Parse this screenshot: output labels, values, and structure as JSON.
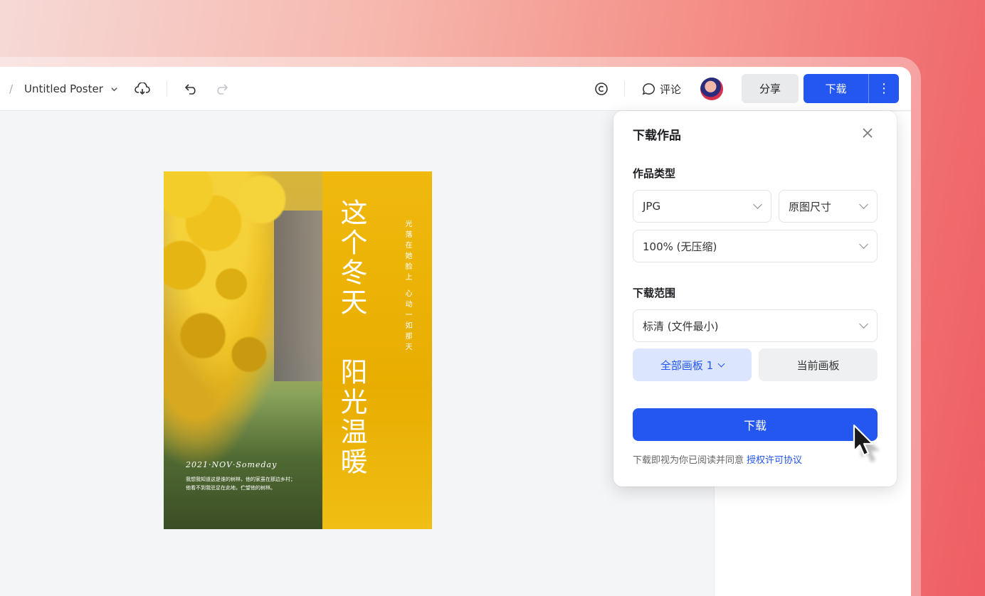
{
  "header": {
    "breadcrumb_ellipsis": ".",
    "breadcrumb_separator": "/",
    "doc_title": "Untitled Poster",
    "comment_label": "评论",
    "share_label": "分享",
    "download_label": "下载",
    "more_glyph": "⋮",
    "icons": [
      "chevron-down-icon",
      "cloud-sync-icon",
      "undo-icon",
      "redo-icon",
      "copyright-icon",
      "comment-icon",
      "more-vertical-icon"
    ]
  },
  "poster": {
    "title_line1": "这个冬天",
    "title_line2": "阳光温暖",
    "vertical_text": "光落在她脸上 心动一如那天",
    "date": "2021·NOV·Someday",
    "desc_line1": "我想我知道这是谁的树林，他的家虽在那边乡村；",
    "desc_line2": "他看不到我驻足在此地，伫望他的树林。"
  },
  "download_panel": {
    "title": "下载作品",
    "type_label": "作品类型",
    "format_value": "JPG",
    "size_value": "原图尺寸",
    "quality_value": "100% (无压缩)",
    "range_label": "下载范围",
    "resolution_value": "标清 (文件最小)",
    "all_boards_label": "全部画板 1",
    "current_board_label": "当前画板",
    "download_button": "下载",
    "agreement_text": "下载即视为你已阅读并同意",
    "agreement_link": "授权许可协议"
  },
  "colors": {
    "primary": "#2456f0",
    "primary_light": "#dbe5fd",
    "poster_yellow": "#e8ad00"
  }
}
